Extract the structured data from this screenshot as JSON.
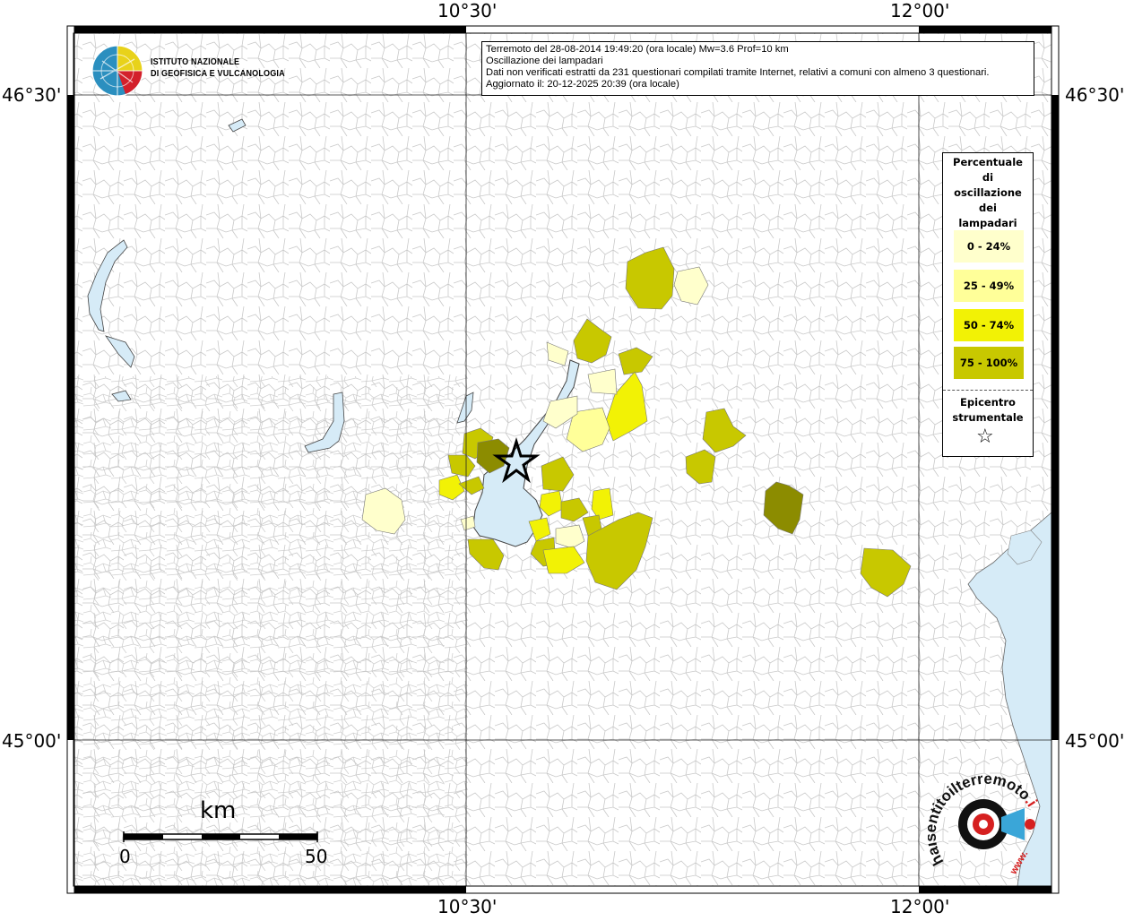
{
  "map": {
    "lon_labels": [
      "10°30'",
      "12°00'"
    ],
    "lat_labels": [
      "46°30'",
      "45°00'"
    ]
  },
  "title_box": {
    "line1": "Terremoto del 28-08-2014 19:49:20 (ora locale) Mw=3.6 Prof=10 km",
    "line2": "Oscillazione dei lampadari",
    "line3": "Dati non verificati estratti da 231 questionari compilati tramite Internet, relativi a comuni con almeno 3 questionari.",
    "line4": "Aggiornato il: 20-12-2025 20:39 (ora locale)"
  },
  "logo_ingv": {
    "line1": "ISTITUTO NAZIONALE",
    "line2": "DI GEOFISICA E VULCANOLOGIA"
  },
  "legend": {
    "title_lines": [
      "Percentuale",
      "di",
      "oscillazione",
      "dei",
      "lampadari"
    ],
    "classes": [
      {
        "label": "0 - 24%",
        "color": "#ffffcc"
      },
      {
        "label": "25 - 49%",
        "color": "#ffff99"
      },
      {
        "label": "50 - 74%",
        "color": "#f2f205"
      },
      {
        "label": "75 - 100%",
        "color": "#c8c800"
      }
    ],
    "epicenter_lines": [
      "Epicentro",
      "strumentale"
    ],
    "epicenter_symbol": "☆"
  },
  "scale": {
    "unit": "km",
    "start": "0",
    "end": "50"
  },
  "logo_hst": {
    "text_main": "haisentitoilterremoto.it",
    "text_part1": "haisentitoil",
    "text_part2": "terremoto",
    "text_part3": ".it",
    "text_www": "www."
  },
  "colors": {
    "lake": "#d6ebf7",
    "sea": "#d6ebf7",
    "dark_olive": "#8c8c00",
    "brand_red": "#d62020"
  }
}
